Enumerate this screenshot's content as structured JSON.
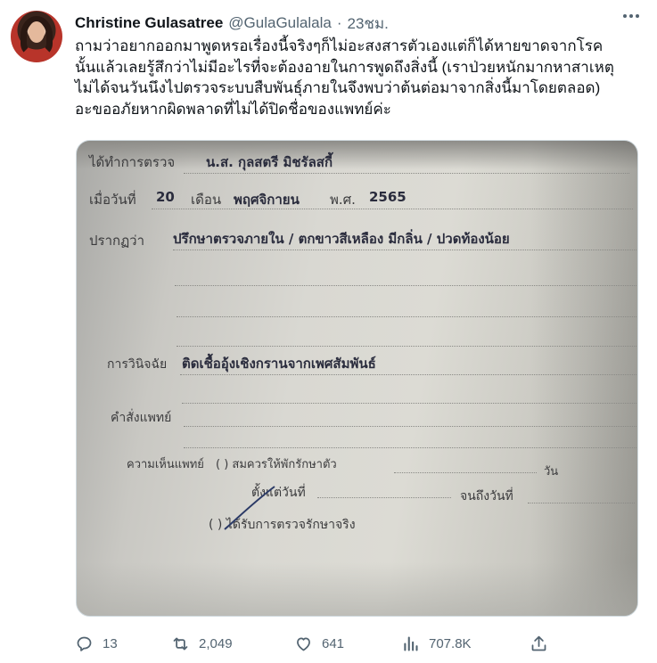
{
  "tweet": {
    "author_name": "Christine Gulasatree",
    "handle": "@GulaGulalala",
    "separator": "·",
    "time": "23ชม.",
    "text_lines": [
      "ถามว่าอยากออกมาพูดหรอเรื่องนี้จริงๆก็ไม่อะสงสารตัวเองแต่ก็ได้หายขาดจากโรค",
      "นั้นแล้วเลยรู้สึกว่าไม่มีอะไรที่จะต้องอายในการพูดถึงสิ่งนี้ (เราป่วยหนักมากหาสาเหตุ",
      "ไม่ได้จนวันนึงไปตรวจระบบสืบพันธุ์ภายในจึงพบว่าต้นต่อมาจากสิ่งนี้มาโดยตลอด)",
      "อะขออภัยหากผิดพลาดที่ไม่ได้ปิดชื่อของแพทย์ค่ะ"
    ]
  },
  "document": {
    "examined_label": "ได้ทำการตรวจ",
    "patient_name": "น.ส. กุลสตรี มิชรัลสกี้",
    "date_label": "เมื่อวันที่",
    "day": "20",
    "month_label": "เดือน",
    "month": "พฤศจิกายน",
    "year_label": "พ.ศ.",
    "year": "2565",
    "findings_label": "ปรากฏว่า",
    "findings": "ปรึกษาตรวจภายใน / ตกขาวสีเหลือง มีกลิ่น / ปวดท้องน้อย",
    "diagnosis_label": "การวินิจฉัย",
    "diagnosis": "ติดเชื้ออุ้งเชิงกรานจากเพศสัมพันธ์",
    "order_label": "คำสั่งแพทย์",
    "opinion_label": "ความเห็นแพทย์",
    "rest_option": "(   ) สมควรให้พักรักษาตัว",
    "days_label": "วัน",
    "from_date_label": "ตั้งแต่วันที่",
    "to_date_label": "จนถึงวันที่",
    "treated_option": "(   ) ได้รับการตรวจรักษาจริง"
  },
  "actions": {
    "replies": "13",
    "retweets": "2,049",
    "likes": "641",
    "views": "707.8K"
  },
  "icons": {
    "more": "more-icon",
    "reply": "reply-icon",
    "retweet": "retweet-icon",
    "like": "heart-icon",
    "views": "views-icon",
    "share": "share-icon"
  },
  "colors": {
    "text": "#0f1419",
    "muted": "#536471",
    "border": "#cfd9de"
  }
}
